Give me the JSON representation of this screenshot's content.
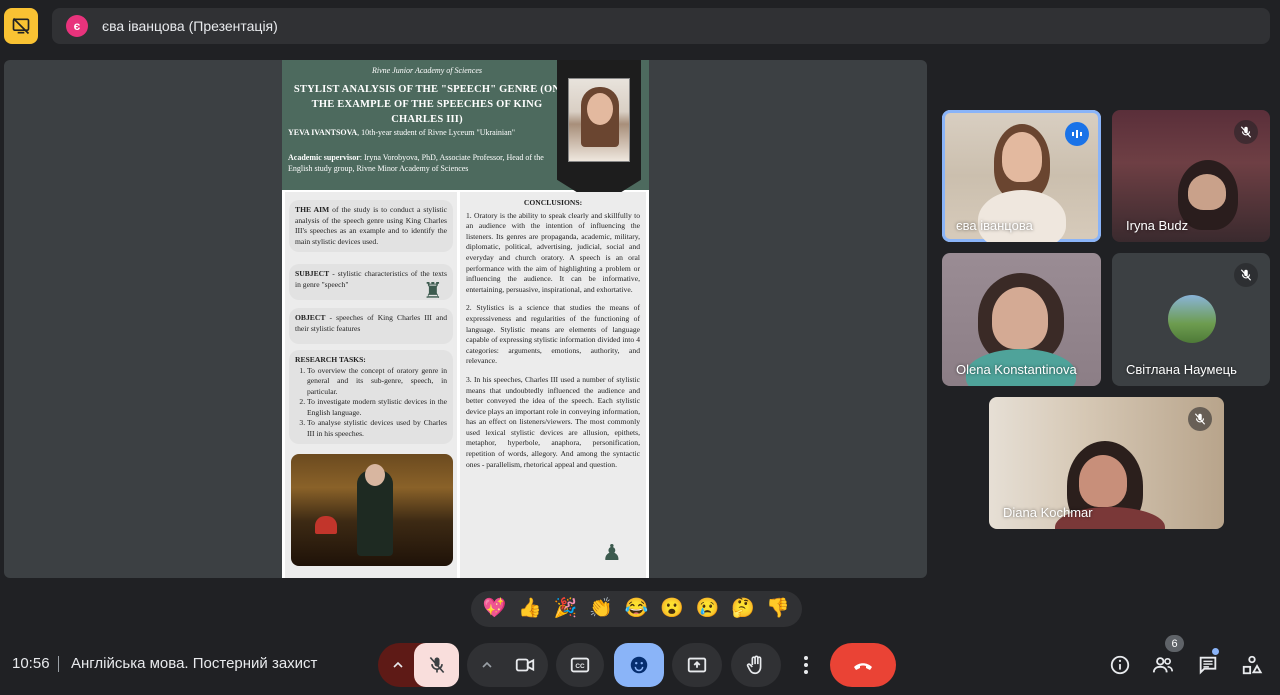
{
  "presenter_bar": {
    "avatar_letter": "є",
    "presenter_label": "єва іванцова (Презентація)"
  },
  "poster": {
    "academy": "Rivne Junior Academy of Sciences",
    "title": "STYLIST ANALYSIS OF THE \"SPEECH\" GENRE (ON THE EXAMPLE OF THE SPEECHES OF KING CHARLES III)",
    "author_name": "YEVA IVANTSOVA",
    "author_rest": ", 10th-year student of Rivne Lyceum \"Ukrainian\"",
    "supervisor_label": "Academic supervisor",
    "supervisor_rest": ": Iryna Vorobyova, PhD, Associate Professor, Head of the English study group, Rivne Minor Academy of Sciences",
    "aim_label": "THE AIM",
    "aim_text": " of the study is to conduct a stylistic analysis of the speech genre using King Charles III's speeches as an example and to identify the main stylistic devices used.",
    "subject_label": "SUBJECT",
    "subject_text": " - stylistic characteristics of the texts in genre \"speech\"",
    "object_label": "OBJECT",
    "object_text": " - speeches of King Charles III and their stylistic features",
    "tasks_label": "RESEARCH TASKS:",
    "tasks": [
      "To overview the concept of oratory genre in general and its sub-genre, speech, in particular.",
      "To investigate modern stylistic devices in the English language.",
      "To analyse stylistic devices used by Charles III in his speeches."
    ],
    "conclusions_label": "CONCLUSIONS:",
    "conclusion_1": "1. Oratory is the ability to speak clearly and skillfully to an audience with the intention of influencing the listeners. Its genres are propaganda, academic, military, diplomatic, political, advertising, judicial, social and everyday and church oratory. A speech is an oral performance with the aim of highlighting a problem or influencing the audience. It can be informative, entertaining, persuasive, inspirational, and exhortative.",
    "conclusion_2": "2. Stylistics is a science that studies the means of expressiveness and regularities of the functioning of language. Stylistic means are elements of language capable of expressing stylistic information divided into 4 categories: arguments, emotions, authority, and relevance.",
    "conclusion_3": "3. In his speeches, Charles III used a number of stylistic means that undoubtedly influenced the audience and better conveyed the idea of the speech. Each stylistic device plays an important role in conveying information, has an effect on listeners/viewers. The most commonly used lexical stylistic devices are allusion, epithets, metaphor, hyperbole, anaphora, personification, repetition of words, allegory. And among the syntactic ones - parallelism, rhetorical appeal and question."
  },
  "participants": [
    {
      "name": "єва іванцова",
      "state": "speaking"
    },
    {
      "name": "Iryna Budz",
      "state": "muted"
    },
    {
      "name": "Olena Konstantinova",
      "state": "video"
    },
    {
      "name": "Світлана Наумець",
      "state": "muted"
    },
    {
      "name": "Diana Kochmar",
      "state": "muted"
    }
  ],
  "reactions": [
    "💖",
    "👍",
    "🎉",
    "👏",
    "😂",
    "😮",
    "😢",
    "🤔",
    "👎"
  ],
  "bottom_bar": {
    "time": "10:56",
    "meeting_title": "Англійська мова. Постерний захист",
    "participant_count": "6"
  },
  "colors": {
    "accent": "#8ab4f8",
    "present_button": "#f9c233",
    "leave_button": "#ea4335",
    "mic_off": "#f9dedc",
    "poster_green": "#4d6a5e"
  },
  "icons": {
    "present": "present-stop-icon",
    "mic": "mic-off-icon",
    "camera": "videocam-icon",
    "captions": "closed-captions-icon",
    "emoji": "emoji-icon",
    "share": "present-to-all-icon",
    "hand": "raise-hand-icon",
    "more": "more-vert-icon",
    "leave": "call-end-icon",
    "info": "info-icon",
    "people": "people-icon",
    "chat": "chat-icon",
    "activities": "activities-icon"
  }
}
